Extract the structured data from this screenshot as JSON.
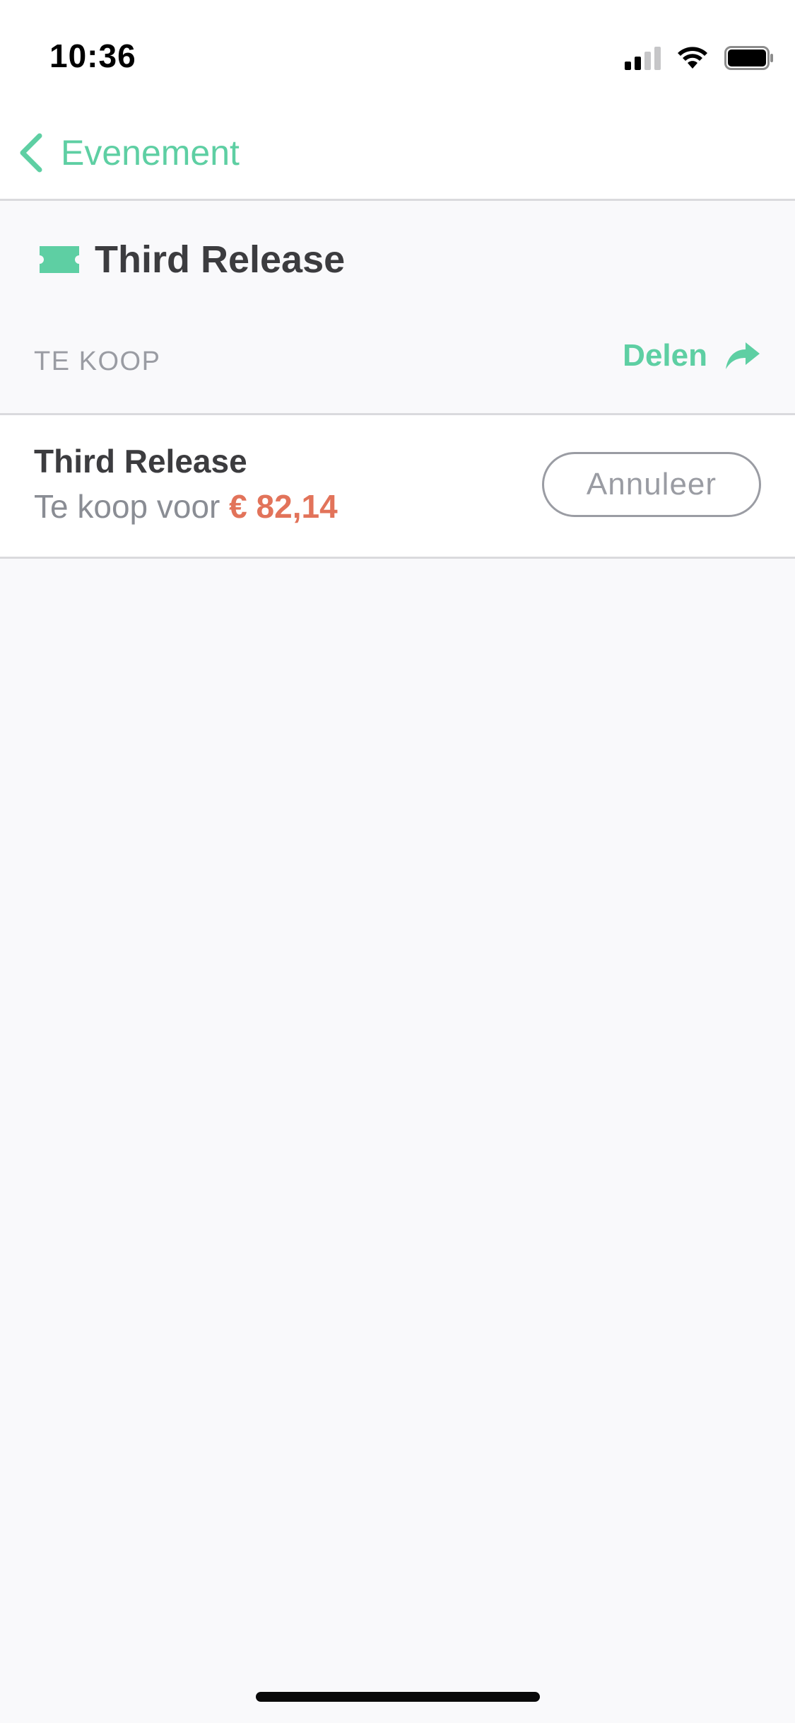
{
  "status_bar": {
    "time": "10:36"
  },
  "nav": {
    "back_label": "Evenement"
  },
  "ticket": {
    "title": "Third Release",
    "section_label": "TE KOOP",
    "share_label": "Delen"
  },
  "listing": {
    "name": "Third Release",
    "price_prefix": "Te koop voor",
    "price": "€ 82,14",
    "cancel_label": "Annuleer"
  },
  "colors": {
    "accent": "#5ecfa3",
    "price": "#e2735a",
    "text_dark": "#3c3c3f",
    "text_muted": "#9a9ca3",
    "background": "#f9f9fb"
  },
  "icons": {
    "back": "chevron-left-icon",
    "ticket": "ticket-icon",
    "share": "share-arrow-icon",
    "signal": "cellular-signal-icon",
    "wifi": "wifi-icon",
    "battery": "battery-icon"
  }
}
